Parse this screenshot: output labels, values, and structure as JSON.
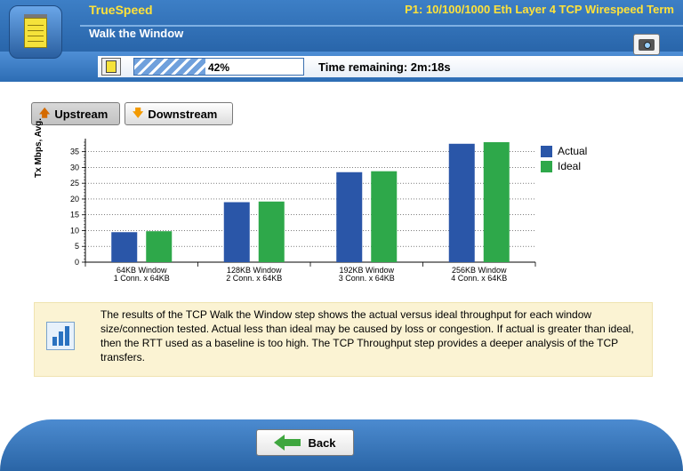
{
  "header": {
    "brand": "TrueSpeed",
    "test_name": "P1: 10/100/1000 Eth Layer 4 TCP Wirespeed Term",
    "step_title": "Walk the Window"
  },
  "progress": {
    "percent": 42,
    "percent_label": "42%",
    "time_remaining": "Time remaining: 2m:18s"
  },
  "direction": {
    "upstream_label": "Upstream",
    "downstream_label": "Downstream",
    "selected": "Upstream"
  },
  "chart_data": {
    "type": "bar",
    "categories": [
      "64KB Window\n1 Conn. x 64KB",
      "128KB Window\n2 Conn. x 64KB",
      "192KB Window\n3 Conn. x 64KB",
      "256KB Window\n4 Conn. x 64KB"
    ],
    "category_lines": [
      [
        "64KB Window",
        "1 Conn. x 64KB"
      ],
      [
        "128KB Window",
        "2 Conn. x 64KB"
      ],
      [
        "192KB Window",
        "3 Conn. x 64KB"
      ],
      [
        "256KB Window",
        "4 Conn. x 64KB"
      ]
    ],
    "series": [
      {
        "name": "Actual",
        "values": [
          9.5,
          19,
          28.5,
          37.5
        ],
        "color": "#2a56a8"
      },
      {
        "name": "Ideal",
        "values": [
          9.8,
          19.2,
          28.8,
          38
        ],
        "color": "#2ea84a"
      }
    ],
    "ylabel": "Tx Mbps, Avg.",
    "ylim": [
      0,
      38
    ],
    "yticks": [
      0,
      5,
      10,
      15,
      20,
      25,
      30,
      35
    ],
    "grid": true,
    "legend_position": "top-right"
  },
  "info": {
    "text": "The results of the TCP Walk the Window step shows the actual versus ideal throughput for each window size/connection tested. Actual less than ideal may be caused by loss or congestion. If actual is greater than ideal, then the RTT used as a baseline is too high. The TCP Throughput step provides a deeper analysis of the TCP transfers."
  },
  "footer": {
    "back_label": "Back"
  },
  "icons": {
    "app": "notepad-icon",
    "camera": "camera-icon",
    "list": "list-icon",
    "upstream": "arrow-up-icon",
    "downstream": "arrow-down-icon",
    "info": "bar-chart-icon",
    "back": "arrow-left-icon"
  }
}
